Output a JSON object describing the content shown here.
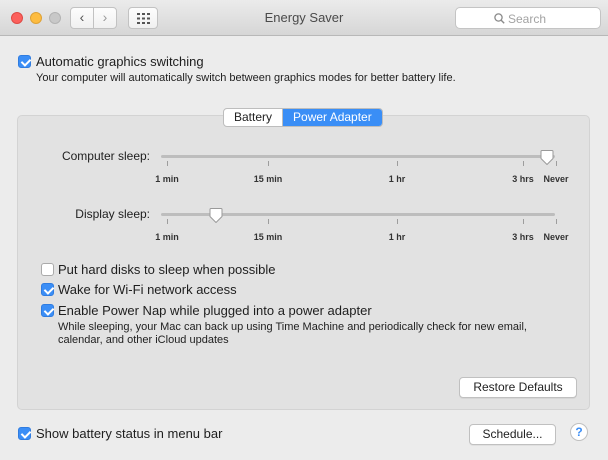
{
  "window": {
    "title": "Energy Saver",
    "search_placeholder": "Search"
  },
  "toolbar": {
    "back_glyph": "‹",
    "forward_glyph": "›"
  },
  "auto_graphics": {
    "label": "Automatic graphics switching",
    "checked": true,
    "description": "Your computer will automatically switch between graphics modes for better battery life."
  },
  "tabs": [
    {
      "label": "Battery",
      "selected": false
    },
    {
      "label": "Power Adapter",
      "selected": true
    }
  ],
  "computer_sleep": {
    "label": "Computer sleep:",
    "value": "Never",
    "position_fraction": 0.98
  },
  "display_sleep": {
    "label": "Display sleep:",
    "value": "3 min",
    "position_fraction": 0.14
  },
  "slider_ticks": [
    "1 min",
    "15 min",
    "1 hr",
    "3 hrs",
    "Never"
  ],
  "options": {
    "hard_disks": {
      "label": "Put hard disks to sleep when possible",
      "checked": false
    },
    "wake_wifi": {
      "label": "Wake for Wi-Fi network access",
      "checked": true
    },
    "power_nap": {
      "label": "Enable Power Nap while plugged into a power adapter",
      "checked": true,
      "description_line1": "While sleeping, your Mac can back up using Time Machine and periodically check for new email,",
      "description_line2": "calendar, and other iCloud updates"
    }
  },
  "restore_defaults_label": "Restore Defaults",
  "battery_status": {
    "label": "Show battery status in menu bar",
    "checked": true
  },
  "schedule_label": "Schedule...",
  "help_glyph": "?",
  "colors": {
    "accent": "#3a8ef6",
    "close": "#fc605c",
    "minimize": "#fdbc40"
  }
}
